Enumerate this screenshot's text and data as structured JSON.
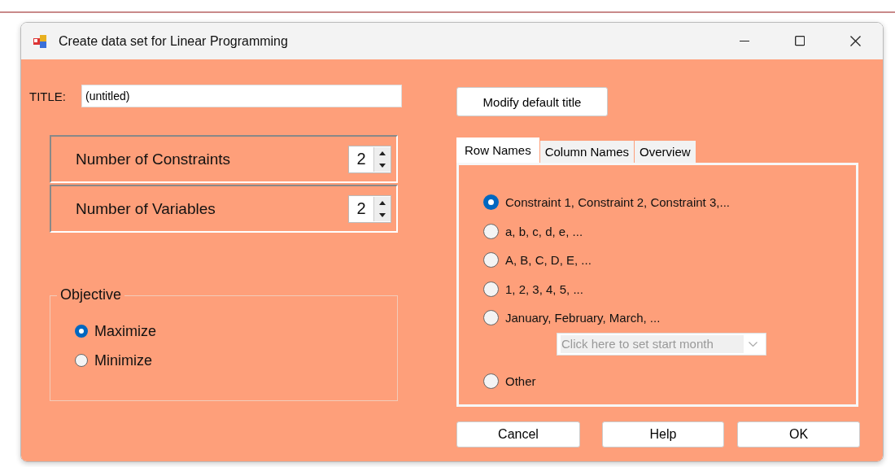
{
  "window": {
    "title": "Create data set for Linear Programming"
  },
  "title_field": {
    "label": "TITLE:",
    "value": "(untitled)"
  },
  "modify_button": "Modify default title",
  "spinners": [
    {
      "label": "Number of Constraints",
      "value": "2"
    },
    {
      "label": "Number of Variables",
      "value": "2"
    }
  ],
  "objective": {
    "legend": "Objective",
    "options": [
      {
        "label": "Maximize",
        "selected": true
      },
      {
        "label": "Minimize",
        "selected": false
      }
    ]
  },
  "tabs": [
    {
      "label": "Row Names",
      "selected": true
    },
    {
      "label": "Column Names",
      "selected": false
    },
    {
      "label": "Overview",
      "selected": false
    }
  ],
  "row_name_options": [
    {
      "label": "Constraint 1, Constraint 2, Constraint 3,...",
      "selected": true
    },
    {
      "label": "a, b, c, d, e, ...",
      "selected": false
    },
    {
      "label": "A, B, C, D, E, ...",
      "selected": false
    },
    {
      "label": "1, 2, 3, 4, 5, ...",
      "selected": false
    },
    {
      "label": "January, February, March, ...",
      "selected": false,
      "dropdown": {
        "placeholder": "Click here to set start month",
        "disabled": true
      }
    },
    {
      "label": "Other",
      "selected": false
    }
  ],
  "buttons": [
    "Cancel",
    "Help",
    "OK"
  ]
}
